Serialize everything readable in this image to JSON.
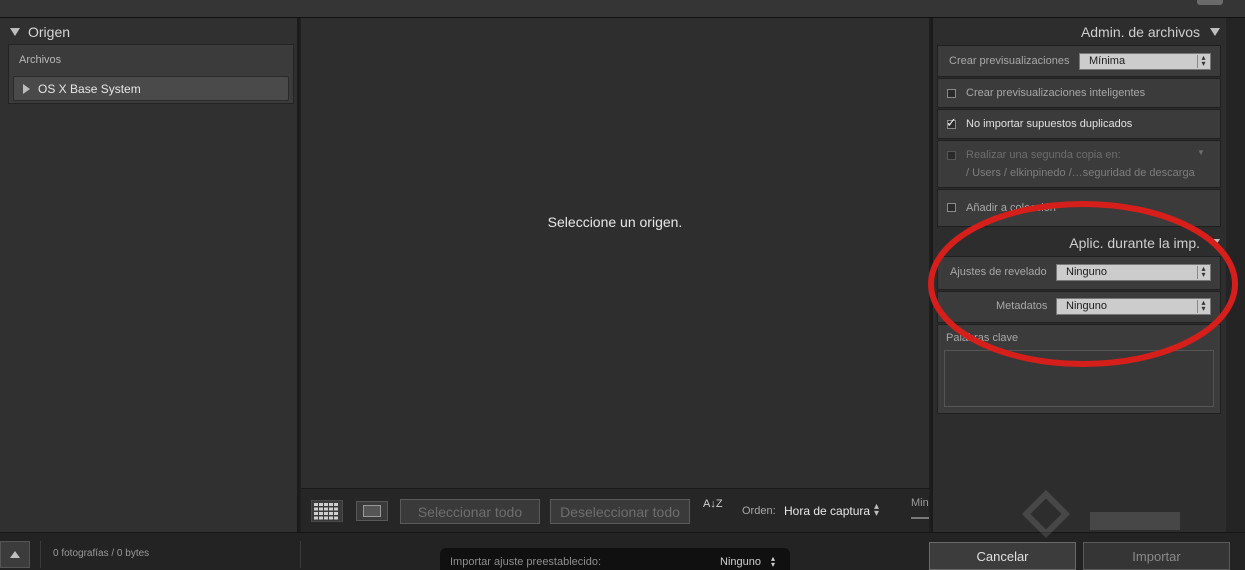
{
  "left_panel": {
    "header": "Origen",
    "section_label": "Archivos",
    "volumes": [
      {
        "label": "OS X Base System"
      }
    ]
  },
  "center": {
    "empty_message": "Seleccione un origen."
  },
  "toolbar": {
    "select_all": "Seleccionar todo",
    "deselect_all": "Deseleccionar todo",
    "sort_icon": "A↓Z",
    "sort_label": "Orden:",
    "sort_value": "Hora de captura",
    "min_label": "Min"
  },
  "file_handling": {
    "header": "Admin. de archivos",
    "build_previews_label": "Crear previsualizaciones",
    "build_previews_value": "Mínima",
    "smart_previews_label": "Crear previsualizaciones inteligentes",
    "smart_previews_checked": false,
    "no_duplicates_label": "No importar supuestos duplicados",
    "no_duplicates_checked": true,
    "second_copy_label": "Realizar una segunda copia en:",
    "second_copy_path": "/ Users / elkinpinedo /…seguridad de descarga",
    "add_collection_label": "Añadir a colección",
    "add_collection_checked": false
  },
  "apply_during_import": {
    "header": "Aplic. durante la imp.",
    "develop_label": "Ajustes de revelado",
    "develop_value": "Ninguno",
    "metadata_label": "Metadatos",
    "metadata_value": "Ninguno",
    "keywords_label": "Palabras clave",
    "keywords_value": ""
  },
  "bottom": {
    "photo_count": "0 fotografías / 0 bytes",
    "preset_label": "Importar ajuste preestablecido:",
    "preset_value": "Ninguno",
    "cancel": "Cancelar",
    "import": "Importar"
  },
  "annotation": {
    "color": "#d61f1a"
  }
}
